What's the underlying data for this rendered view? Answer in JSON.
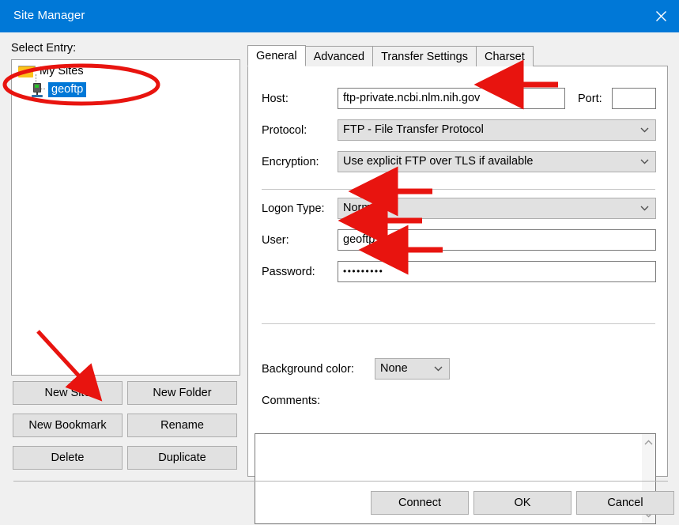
{
  "window": {
    "title": "Site Manager",
    "close_icon": "close-icon",
    "titlebar_color": "#0078d7"
  },
  "left_panel": {
    "select_entry_label": "Select Entry:",
    "tree": {
      "root": {
        "label": "My Sites",
        "icon": "folder-icon"
      },
      "children": [
        {
          "label": "geoftp",
          "icon": "server-icon",
          "selected": true
        }
      ]
    },
    "buttons": [
      {
        "label": "New Site"
      },
      {
        "label": "New Folder"
      },
      {
        "label": "New Bookmark"
      },
      {
        "label": "Rename"
      },
      {
        "label": "Delete"
      },
      {
        "label": "Duplicate"
      }
    ]
  },
  "tabs": [
    {
      "label": "General",
      "active": true
    },
    {
      "label": "Advanced",
      "active": false
    },
    {
      "label": "Transfer Settings",
      "active": false
    },
    {
      "label": "Charset",
      "active": false
    }
  ],
  "general": {
    "host_label": "Host:",
    "host_value": "ftp-private.ncbi.nlm.nih.gov",
    "port_label": "Port:",
    "port_value": "",
    "protocol_label": "Protocol:",
    "protocol_value": "FTP - File Transfer Protocol",
    "encryption_label": "Encryption:",
    "encryption_value": "Use explicit FTP over TLS if available",
    "logon_type_label": "Logon Type:",
    "logon_type_value": "Normal",
    "user_label": "User:",
    "user_value": "geoftp",
    "password_label": "Password:",
    "password_value": "•••••••••",
    "background_color_label": "Background color:",
    "background_color_value": "None",
    "comments_label": "Comments:",
    "comments_value": "",
    "scroll_up_icon": "chevron-up-icon",
    "scroll_down_icon": "chevron-down-icon",
    "dropdown_icon": "chevron-down-icon"
  },
  "footer": {
    "connect_label": "Connect",
    "ok_label": "OK",
    "cancel_label": "Cancel"
  },
  "annotations": {
    "highlight_color": "#e8140f",
    "ellipse_target": "geoftp-tree-entry",
    "arrows": [
      "arrow-to-new-site-button",
      "arrow-to-host-field",
      "arrow-to-logon-type",
      "arrow-to-user-field",
      "arrow-to-password-field"
    ]
  }
}
